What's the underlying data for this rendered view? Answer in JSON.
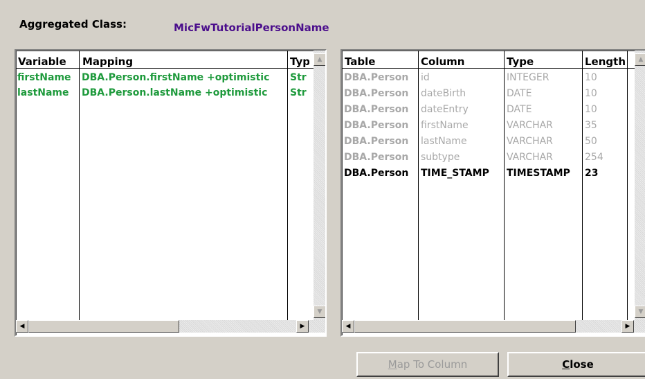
{
  "aggregated_class": {
    "label": "Aggregated Class:",
    "value": "MicFwTutorialPersonName"
  },
  "mapping_table": {
    "columns": [
      "Variable",
      "Mapping",
      "Typ"
    ],
    "rows": [
      {
        "variable": "firstName",
        "mapping": "DBA.Person.firstName +optimistic",
        "type": "Str"
      },
      {
        "variable": "lastName",
        "mapping": "DBA.Person.lastName +optimistic",
        "type": "Str"
      }
    ]
  },
  "column_table": {
    "columns": [
      "Table",
      "Column",
      "Type",
      "Length"
    ],
    "rows": [
      {
        "table": "DBA.Person",
        "column": "id",
        "type": "INTEGER",
        "length": "10",
        "style": "gray"
      },
      {
        "table": "DBA.Person",
        "column": "dateBirth",
        "type": "DATE",
        "length": "10",
        "style": "gray"
      },
      {
        "table": "DBA.Person",
        "column": "dateEntry",
        "type": "DATE",
        "length": "10",
        "style": "gray"
      },
      {
        "table": "DBA.Person",
        "column": "firstName",
        "type": "VARCHAR",
        "length": "35",
        "style": "gray"
      },
      {
        "table": "DBA.Person",
        "column": "lastName",
        "type": "VARCHAR",
        "length": "50",
        "style": "gray"
      },
      {
        "table": "DBA.Person",
        "column": "subtype",
        "type": "VARCHAR",
        "length": "254",
        "style": "gray"
      },
      {
        "table": "DBA.Person",
        "column": "TIME_STAMP",
        "type": "TIMESTAMP",
        "length": "23",
        "style": "black"
      }
    ]
  },
  "buttons": {
    "map_to_column": {
      "pre": "",
      "accel": "M",
      "post": "ap To Column"
    },
    "close": {
      "pre": "",
      "accel": "C",
      "post": "lose"
    }
  },
  "colors": {
    "class_name": "#4b0e8c",
    "mapped_row": "#1e9a3c",
    "unmapped_row": "#a8a8a8"
  },
  "icons": [
    "scroll-up-arrow-icon",
    "scroll-down-arrow-icon",
    "scroll-left-arrow-icon",
    "scroll-right-arrow-icon"
  ]
}
